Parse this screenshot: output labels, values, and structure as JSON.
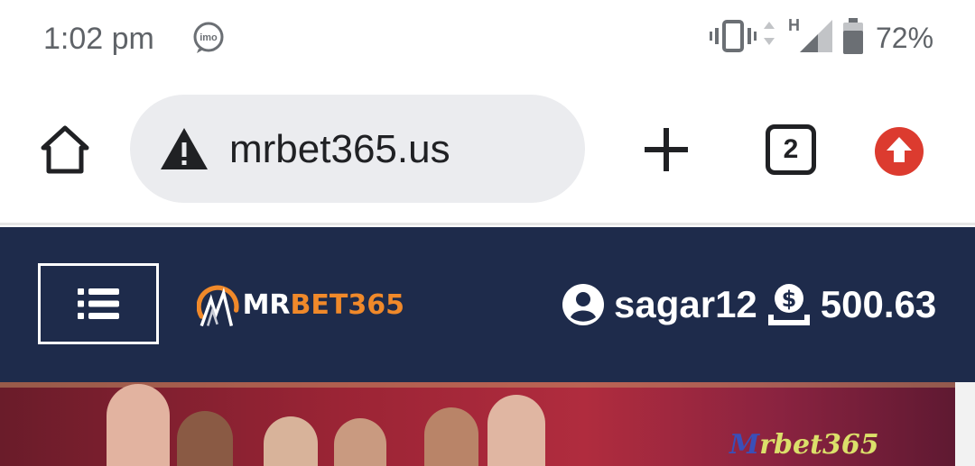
{
  "status_bar": {
    "time": "1:02 pm",
    "notification_icon": "imo-icon",
    "battery_percent": "72%",
    "network_type": "H"
  },
  "browser": {
    "url": "mrbet365.us",
    "security_icon": "warning-icon",
    "tab_count": "2"
  },
  "site": {
    "logo_mr": "MR",
    "logo_bet": "BET365",
    "username": "sagar12",
    "balance": "500.63",
    "colors": {
      "header_bg": "#1e2b4b",
      "accent": "#f0892a"
    }
  },
  "banner": {
    "logo_first": "M",
    "logo_rest": "rbet365"
  }
}
